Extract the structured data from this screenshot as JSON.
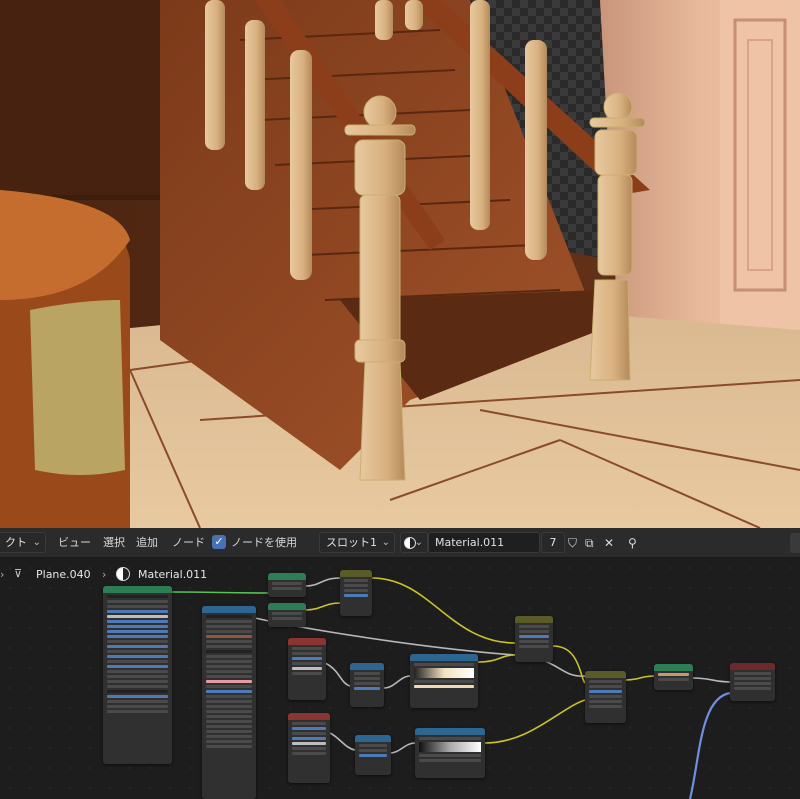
{
  "header": {
    "editor_type_label": "クト",
    "menu": [
      "ビュー",
      "選択",
      "追加",
      "ノード"
    ],
    "use_nodes_label": "ノードを使用",
    "use_nodes_checked": true,
    "slot_label": "スロット1",
    "material_name": "Material.011",
    "user_count": "7"
  },
  "breadcrumb": {
    "object_name": "Plane.040",
    "material_name": "Material.011"
  },
  "colors": {
    "wire_yellow": "#c9c22b",
    "wire_grey": "#b8b8b8",
    "wire_green": "#58c258",
    "wire_blue": "#6f8fe0",
    "node_header_green": "#2f7d52",
    "node_header_blue": "#2e6692",
    "node_header_red": "#8a3434",
    "node_header_olive": "#5b5b2a",
    "node_header_darkred": "#6e2a2a"
  }
}
